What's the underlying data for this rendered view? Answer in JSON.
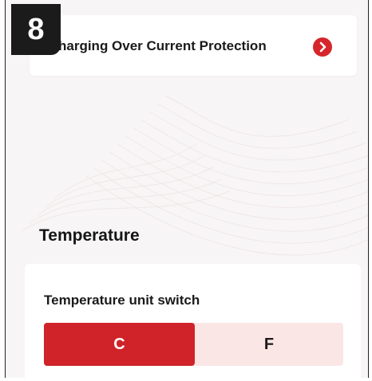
{
  "step_badge": "8",
  "protection_item": {
    "label": "harging Over Current Protection",
    "arrow_icon": "chevron-right-icon"
  },
  "temperature": {
    "section_title": "Temperature",
    "unit_switch_label": "Temperature unit switch",
    "options": [
      "C",
      "F"
    ],
    "selected": "C"
  },
  "colors": {
    "accent": "#cf2329",
    "switch_inactive_bg": "#fbe6e6",
    "page_bg": "#f7f5f5"
  }
}
